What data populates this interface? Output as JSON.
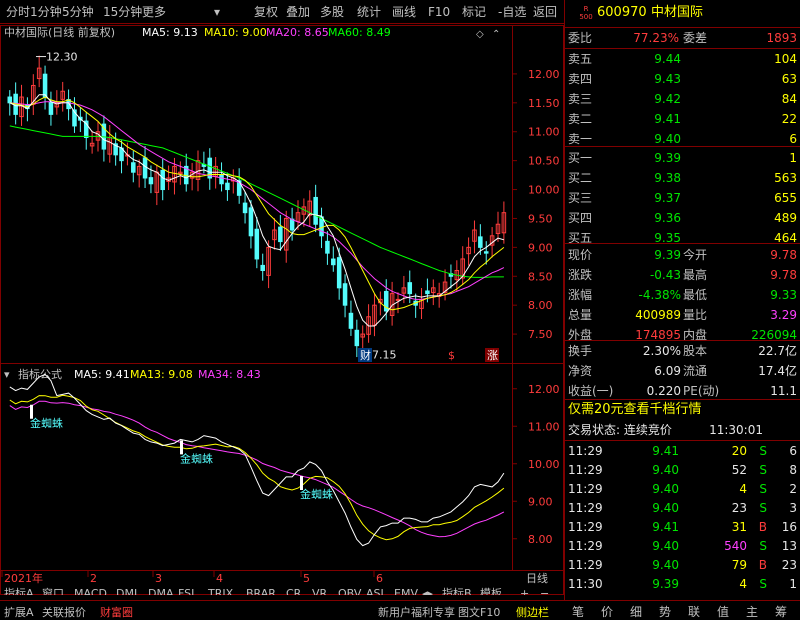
{
  "toolbar": {
    "items": [
      "分时",
      "1分钟",
      "5分钟",
      "15分钟",
      "更多",
      "复权",
      "叠加",
      "多股",
      "统计",
      "画线",
      "F10",
      "标记",
      "-自选",
      "返回"
    ]
  },
  "colors": {
    "ma5": "#ffffff",
    "ma10": "#ffff00",
    "ma20": "#ff40ff",
    "ma60": "#00ff00",
    "up": "#ff3c3c",
    "down": "#54fcfc",
    "grid": "#800000"
  },
  "chart_data": [
    {
      "type": "candlestick",
      "title": "中材国际(日线 前复权)",
      "legend": [
        {
          "name": "MA5",
          "value": "9.13",
          "color": "#ffffff"
        },
        {
          "name": "MA10",
          "value": "9.00",
          "color": "#ffff00"
        },
        {
          "name": "MA20",
          "value": "8.65",
          "color": "#ff40ff"
        },
        {
          "name": "MA60",
          "value": "8.49",
          "color": "#00ff00"
        }
      ],
      "ylim": [
        7.0,
        12.5
      ],
      "yticks": [
        "12.00",
        "11.50",
        "11.00",
        "10.50",
        "10.00",
        "9.50",
        "9.00",
        "8.50",
        "8.00",
        "7.50"
      ],
      "high_label": "12.30",
      "low_label": "7.15",
      "markers": [
        "财",
        "$",
        "涨"
      ],
      "close": [
        11.5,
        11.3,
        11.6,
        11.4,
        11.8,
        12.1,
        11.6,
        11.3,
        11.5,
        11.7,
        11.4,
        11.1,
        11.2,
        10.9,
        10.8,
        11.0,
        10.7,
        10.9,
        10.6,
        10.5,
        10.6,
        10.3,
        10.4,
        10.2,
        10.1,
        10.3,
        10.0,
        10.2,
        10.4,
        10.3,
        10.1,
        10.3,
        10.5,
        10.4,
        10.2,
        10.4,
        10.1,
        10.0,
        10.2,
        9.9,
        9.6,
        9.2,
        8.8,
        8.6,
        9.0,
        9.3,
        9.1,
        9.5,
        9.3,
        9.6,
        9.7,
        9.8,
        9.4,
        9.2,
        8.9,
        8.7,
        8.3,
        8.0,
        7.6,
        7.3,
        7.5,
        7.8,
        8.0,
        8.1,
        7.9,
        8.2,
        8.1,
        8.3,
        8.2,
        8.0,
        8.1,
        8.2,
        8.3,
        8.2,
        8.4,
        8.5,
        8.6,
        8.8,
        9.0,
        9.3,
        9.0,
        8.9,
        9.2,
        9.4,
        9.6
      ],
      "ma5": [
        11.5,
        11.45,
        11.45,
        11.4,
        11.52,
        11.64,
        11.64,
        11.52,
        11.48,
        11.5,
        11.5,
        11.34,
        11.22,
        11.14,
        11.0,
        10.96,
        10.86,
        10.82,
        10.76,
        10.72,
        10.6,
        10.52,
        10.48,
        10.4,
        10.34,
        10.3,
        10.2,
        10.16,
        10.2,
        10.24,
        10.2,
        10.26,
        10.32,
        10.34,
        10.3,
        10.3,
        10.3,
        10.24,
        10.2,
        10.14,
        9.96,
        9.76,
        9.5,
        9.2,
        9.02,
        8.98,
        8.96,
        9.1,
        9.24,
        9.36,
        9.44,
        9.58,
        9.56,
        9.54,
        9.36,
        9.2,
        8.9,
        8.62,
        8.3,
        7.98,
        7.74,
        7.64,
        7.64,
        7.74,
        7.86,
        8.0,
        8.06,
        8.12,
        8.14,
        8.16,
        8.14,
        8.16,
        8.16,
        8.16,
        8.24,
        8.32,
        8.4,
        8.5,
        8.66,
        8.84,
        8.94,
        9.0,
        9.08,
        9.16,
        9.13
      ],
      "ma10": [
        11.5,
        11.48,
        11.46,
        11.43,
        11.48,
        11.55,
        11.6,
        11.55,
        11.52,
        11.52,
        11.55,
        11.5,
        11.42,
        11.34,
        11.26,
        11.18,
        11.06,
        10.96,
        10.88,
        10.82,
        10.74,
        10.68,
        10.62,
        10.56,
        10.48,
        10.42,
        10.36,
        10.3,
        10.28,
        10.26,
        10.24,
        10.22,
        10.22,
        10.24,
        10.26,
        10.26,
        10.26,
        10.26,
        10.24,
        10.22,
        10.16,
        10.06,
        9.9,
        9.74,
        9.58,
        9.48,
        9.38,
        9.32,
        9.24,
        9.22,
        9.22,
        9.26,
        9.3,
        9.34,
        9.38,
        9.38,
        9.3,
        9.18,
        9.0,
        8.8,
        8.6,
        8.4,
        8.2,
        8.04,
        7.96,
        7.92,
        7.94,
        7.96,
        8.0,
        8.04,
        8.08,
        8.12,
        8.14,
        8.16,
        8.18,
        8.22,
        8.28,
        8.36,
        8.44,
        8.56,
        8.66,
        8.74,
        8.84,
        8.92,
        9.0
      ],
      "ma20": [
        11.5,
        11.49,
        11.48,
        11.47,
        11.48,
        11.5,
        11.52,
        11.52,
        11.51,
        11.5,
        11.5,
        11.48,
        11.46,
        11.42,
        11.38,
        11.32,
        11.26,
        11.18,
        11.1,
        11.02,
        10.94,
        10.86,
        10.78,
        10.72,
        10.66,
        10.6,
        10.54,
        10.48,
        10.44,
        10.4,
        10.36,
        10.32,
        10.28,
        10.26,
        10.24,
        10.22,
        10.2,
        10.18,
        10.16,
        10.12,
        10.06,
        10.0,
        9.92,
        9.84,
        9.76,
        9.68,
        9.6,
        9.54,
        9.48,
        9.44,
        9.4,
        9.36,
        9.32,
        9.28,
        9.24,
        9.18,
        9.1,
        9.0,
        8.9,
        8.78,
        8.66,
        8.56,
        8.46,
        8.38,
        8.3,
        8.24,
        8.2,
        8.16,
        8.12,
        8.1,
        8.1,
        8.12,
        8.14,
        8.16,
        8.18,
        8.2,
        8.24,
        8.28,
        8.32,
        8.38,
        8.44,
        8.5,
        8.56,
        8.6,
        8.65
      ],
      "ma60": [
        11.1,
        11.08,
        11.06,
        11.04,
        11.02,
        11.0,
        10.98,
        10.96,
        10.94,
        10.92,
        10.92,
        10.92,
        10.92,
        10.92,
        10.92,
        10.92,
        10.91,
        10.9,
        10.88,
        10.86,
        10.84,
        10.82,
        10.8,
        10.78,
        10.76,
        10.74,
        10.72,
        10.68,
        10.64,
        10.6,
        10.56,
        10.52,
        10.48,
        10.44,
        10.4,
        10.36,
        10.32,
        10.28,
        10.24,
        10.2,
        10.15,
        10.1,
        10.05,
        10.0,
        9.95,
        9.9,
        9.85,
        9.8,
        9.75,
        9.7,
        9.65,
        9.6,
        9.55,
        9.5,
        9.45,
        9.4,
        9.35,
        9.3,
        9.25,
        9.2,
        9.15,
        9.1,
        9.05,
        9.0,
        8.96,
        8.92,
        8.88,
        8.84,
        8.8,
        8.76,
        8.72,
        8.68,
        8.64,
        8.6,
        8.57,
        8.54,
        8.52,
        8.5,
        8.49,
        8.48,
        8.48,
        8.48,
        8.49,
        8.49,
        8.49
      ]
    },
    {
      "type": "line",
      "title": "指标公式",
      "legend": [
        {
          "name": "MA5",
          "value": "9.41",
          "color": "#ffffff"
        },
        {
          "name": "MA13",
          "value": "9.08",
          "color": "#ffff00"
        },
        {
          "name": "MA34",
          "value": "8.43",
          "color": "#ff40ff"
        }
      ],
      "ylim": [
        7.3,
        12.5
      ],
      "yticks": [
        "12.00",
        "11.00",
        "10.00",
        "9.00",
        "8.00"
      ],
      "annotations": [
        "金蜘蛛",
        "金蜘蛛",
        "金蜘蛛"
      ],
      "x_labels": [
        "2021年",
        "2",
        "3",
        "4",
        "5",
        "6"
      ]
    }
  ],
  "right_panel": {
    "code": "600970",
    "name": "中材国际",
    "badge_top": "R",
    "badge_bottom": "500",
    "webi_label": "委比",
    "webi_value": "77.23%",
    "weicha_label": "委差",
    "weicha_value": "1893",
    "sell": [
      {
        "label": "卖五",
        "price": "9.44",
        "vol": "104"
      },
      {
        "label": "卖四",
        "price": "9.43",
        "vol": "63"
      },
      {
        "label": "卖三",
        "price": "9.42",
        "vol": "84"
      },
      {
        "label": "卖二",
        "price": "9.41",
        "vol": "22"
      },
      {
        "label": "卖一",
        "price": "9.40",
        "vol": "6"
      }
    ],
    "buy": [
      {
        "label": "买一",
        "price": "9.39",
        "vol": "1"
      },
      {
        "label": "买二",
        "price": "9.38",
        "vol": "563"
      },
      {
        "label": "买三",
        "price": "9.37",
        "vol": "655"
      },
      {
        "label": "买四",
        "price": "9.36",
        "vol": "489"
      },
      {
        "label": "买五",
        "price": "9.35",
        "vol": "464"
      }
    ],
    "stats": [
      {
        "l1": "现价",
        "v1": "9.39",
        "c1": "green",
        "l2": "今开",
        "v2": "9.78",
        "c2": "red"
      },
      {
        "l1": "涨跌",
        "v1": "-0.43",
        "c1": "green",
        "l2": "最高",
        "v2": "9.78",
        "c2": "red"
      },
      {
        "l1": "涨幅",
        "v1": "-4.38%",
        "c1": "green",
        "l2": "最低",
        "v2": "9.33",
        "c2": "green"
      },
      {
        "l1": "总量",
        "v1": "400989",
        "c1": "yel",
        "l2": "量比",
        "v2": "3.29",
        "c2": "mag"
      },
      {
        "l1": "外盘",
        "v1": "174895",
        "c1": "red",
        "l2": "内盘",
        "v2": "226094",
        "c2": "green"
      }
    ],
    "stats2": [
      {
        "l1": "换手",
        "v1": "2.30%",
        "l2": "股本",
        "v2": "22.7亿"
      },
      {
        "l1": "净资",
        "v1": "6.09",
        "l2": "流通",
        "v2": "17.4亿"
      },
      {
        "l1": "收益(一)",
        "v1": "0.220",
        "l2": "PE(动)",
        "v2": "11.1"
      }
    ],
    "promo": "仅需20元查看千档行情",
    "status_label": "交易状态: 连续竞价",
    "status_time": "11:30:01",
    "ticks": [
      {
        "t": "11:29",
        "p": "9.41",
        "v": "20",
        "vc": "yel",
        "s": "S",
        "n": "6"
      },
      {
        "t": "11:29",
        "p": "9.40",
        "v": "52",
        "vc": "wht",
        "s": "S",
        "n": "8"
      },
      {
        "t": "11:29",
        "p": "9.40",
        "v": "4",
        "vc": "yel",
        "s": "S",
        "n": "2"
      },
      {
        "t": "11:29",
        "p": "9.40",
        "v": "23",
        "vc": "wht",
        "s": "S",
        "n": "3"
      },
      {
        "t": "11:29",
        "p": "9.41",
        "v": "31",
        "vc": "yel",
        "s": "B",
        "n": "16"
      },
      {
        "t": "11:29",
        "p": "9.40",
        "v": "540",
        "vc": "mag",
        "s": "S",
        "n": "13"
      },
      {
        "t": "11:29",
        "p": "9.40",
        "v": "79",
        "vc": "yel",
        "s": "B",
        "n": "23"
      },
      {
        "t": "11:30",
        "p": "9.39",
        "v": "4",
        "vc": "yel",
        "s": "S",
        "n": "1"
      }
    ],
    "bottom_tabs": [
      "笔",
      "价",
      "细",
      "势",
      "联",
      "值",
      "主",
      "筹"
    ]
  },
  "bottom_bar": {
    "row1": [
      "指标A",
      "窗口",
      "MACD",
      "DMI",
      "DMA",
      "FSL",
      "TRIX",
      "BRAR",
      "CR",
      "VR",
      "OBV",
      "ASI",
      "EMV",
      "指标B",
      "模板"
    ],
    "row2": [
      "扩展A",
      "关联报价",
      "财富圈",
      "新用户福利专享",
      "图文F10",
      "侧边栏"
    ],
    "period": "日线"
  }
}
